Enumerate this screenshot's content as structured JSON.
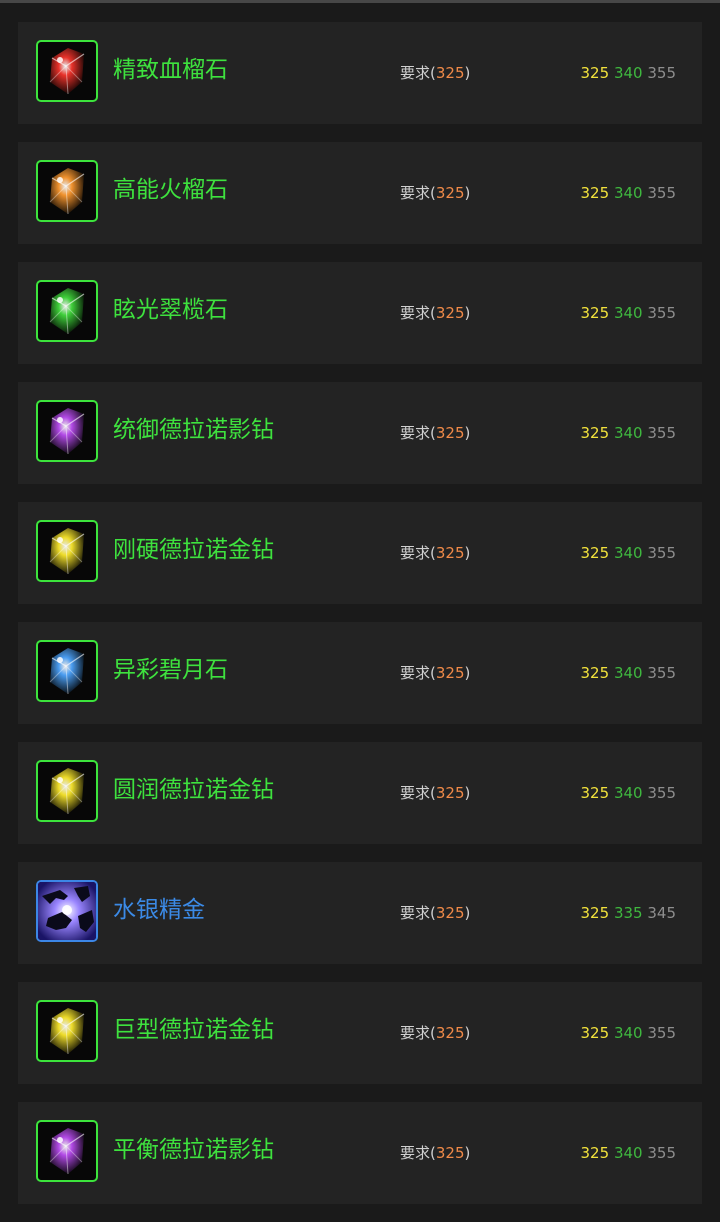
{
  "colors": {
    "background": "#1a1a1a",
    "row_background": "#232323",
    "name_green": "#3ee23e",
    "name_blue": "#3b8ae6",
    "requirement_orange": "#f08a48",
    "skill_yellow": "#f2e23c",
    "skill_green": "#3fb83f",
    "skill_grey": "#8e8e8e"
  },
  "items": [
    {
      "name": "精致血榴石",
      "icon": "red-gem-icon",
      "gem_color": "#e8322a",
      "name_color": "green",
      "req_prefix": "要求(",
      "req_level": "325",
      "req_suffix": ")",
      "skill_yellow": "325",
      "skill_green": "340",
      "skill_grey": "355"
    },
    {
      "name": "高能火榴石",
      "icon": "orange-gem-icon",
      "gem_color": "#f0922e",
      "name_color": "green",
      "req_prefix": "要求(",
      "req_level": "325",
      "req_suffix": ")",
      "skill_yellow": "325",
      "skill_green": "340",
      "skill_grey": "355"
    },
    {
      "name": "眩光翠榄石",
      "icon": "green-gem-icon",
      "gem_color": "#3fcf3a",
      "name_color": "green",
      "req_prefix": "要求(",
      "req_level": "325",
      "req_suffix": ")",
      "skill_yellow": "325",
      "skill_green": "340",
      "skill_grey": "355"
    },
    {
      "name": "统御德拉诺影钻",
      "icon": "purple-gem-icon",
      "gem_color": "#b24ae6",
      "name_color": "green",
      "req_prefix": "要求(",
      "req_level": "325",
      "req_suffix": ")",
      "skill_yellow": "325",
      "skill_green": "340",
      "skill_grey": "355"
    },
    {
      "name": "刚硬德拉诺金钻",
      "icon": "yellow-gem-icon",
      "gem_color": "#eedc2a",
      "name_color": "green",
      "req_prefix": "要求(",
      "req_level": "325",
      "req_suffix": ")",
      "skill_yellow": "325",
      "skill_green": "340",
      "skill_grey": "355"
    },
    {
      "name": "异彩碧月石",
      "icon": "blue-gem-icon",
      "gem_color": "#4a9cf0",
      "name_color": "green",
      "req_prefix": "要求(",
      "req_level": "325",
      "req_suffix": ")",
      "skill_yellow": "325",
      "skill_green": "340",
      "skill_grey": "355"
    },
    {
      "name": "圆润德拉诺金钻",
      "icon": "yellow-gem-icon",
      "gem_color": "#eedc2a",
      "name_color": "green",
      "req_prefix": "要求(",
      "req_level": "325",
      "req_suffix": ")",
      "skill_yellow": "325",
      "skill_green": "340",
      "skill_grey": "355"
    },
    {
      "name": "水银精金",
      "icon": "alchemy-hands-icon",
      "gem_color": "#6a4ae6",
      "name_color": "blue",
      "req_prefix": "要求(",
      "req_level": "325",
      "req_suffix": ")",
      "skill_yellow": "325",
      "skill_green": "335",
      "skill_grey": "345"
    },
    {
      "name": "巨型德拉诺金钻",
      "icon": "yellow-gem-icon",
      "gem_color": "#eedc2a",
      "name_color": "green",
      "req_prefix": "要求(",
      "req_level": "325",
      "req_suffix": ")",
      "skill_yellow": "325",
      "skill_green": "340",
      "skill_grey": "355"
    },
    {
      "name": "平衡德拉诺影钻",
      "icon": "purple-gem-icon",
      "gem_color": "#b24ae6",
      "name_color": "green",
      "req_prefix": "要求(",
      "req_level": "325",
      "req_suffix": ")",
      "skill_yellow": "325",
      "skill_green": "340",
      "skill_grey": "355"
    }
  ]
}
